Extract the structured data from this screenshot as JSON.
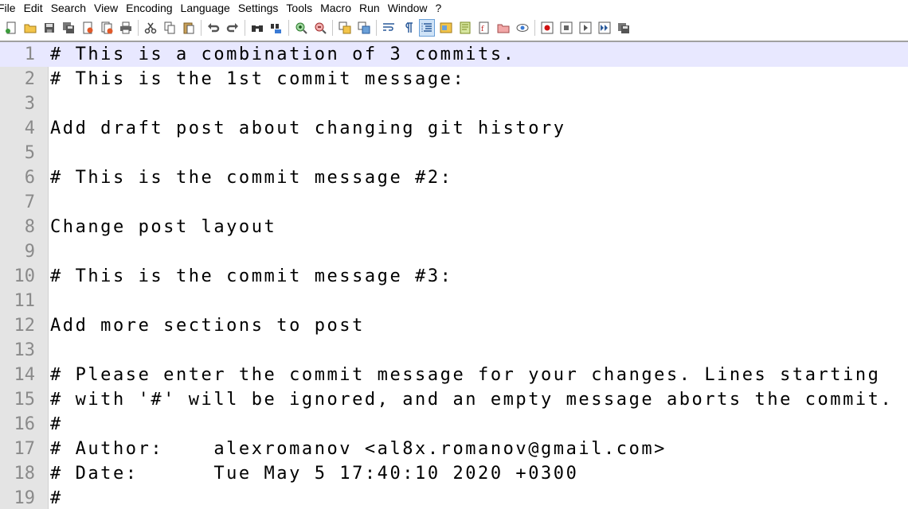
{
  "menu": [
    "File",
    "Edit",
    "Search",
    "View",
    "Encoding",
    "Language",
    "Settings",
    "Tools",
    "Macro",
    "Run",
    "Window",
    "?"
  ],
  "toolbar_icons": [
    "new-file-icon",
    "open-file-icon",
    "save-icon",
    "save-all-icon",
    "close-icon",
    "close-all-icon",
    "print-icon",
    "|",
    "cut-icon",
    "copy-icon",
    "paste-icon",
    "|",
    "undo-icon",
    "redo-icon",
    "|",
    "find-icon",
    "replace-icon",
    "|",
    "zoom-in-icon",
    "zoom-out-icon",
    "|",
    "sync-vertical-icon",
    "sync-horizontal-icon",
    "|",
    "word-wrap-icon",
    "show-all-chars-icon",
    "indent-guide-icon",
    "folder-as-workspace-icon",
    "document-map-icon",
    "function-list-icon",
    "doc-list-icon",
    "monitoring-icon",
    "|",
    "record-macro-icon",
    "stop-macro-icon",
    "play-macro-icon",
    "run-macro-multiple-icon",
    "save-macro-icon"
  ],
  "active_toolbar_icon": "indent-guide-icon",
  "current_line": 1,
  "colors": {
    "gutter": "#e4e4e4",
    "current_line": "#e8e8ff",
    "line_number": "#8a8a8a",
    "text": "#000000"
  },
  "lines": [
    {
      "n": "1",
      "text": "# This is a combination of 3 commits."
    },
    {
      "n": "2",
      "text": "# This is the 1st commit message:"
    },
    {
      "n": "3",
      "text": ""
    },
    {
      "n": "4",
      "text": "Add draft post about changing git history"
    },
    {
      "n": "5",
      "text": ""
    },
    {
      "n": "6",
      "text": "# This is the commit message #2:"
    },
    {
      "n": "7",
      "text": ""
    },
    {
      "n": "8",
      "text": "Change post layout"
    },
    {
      "n": "9",
      "text": ""
    },
    {
      "n": "10",
      "text": "# This is the commit message #3:"
    },
    {
      "n": "11",
      "text": ""
    },
    {
      "n": "12",
      "text": "Add more sections to post"
    },
    {
      "n": "13",
      "text": ""
    },
    {
      "n": "14",
      "text": "# Please enter the commit message for your changes. Lines starting"
    },
    {
      "n": "15",
      "text": "# with '#' will be ignored, and an empty message aborts the commit."
    },
    {
      "n": "16",
      "text": "#"
    },
    {
      "n": "17",
      "text": "# Author:    alexromanov <al8x.romanov@gmail.com>"
    },
    {
      "n": "18",
      "text": "# Date:      Tue May 5 17:40:10 2020 +0300"
    },
    {
      "n": "19",
      "text": "#"
    }
  ]
}
